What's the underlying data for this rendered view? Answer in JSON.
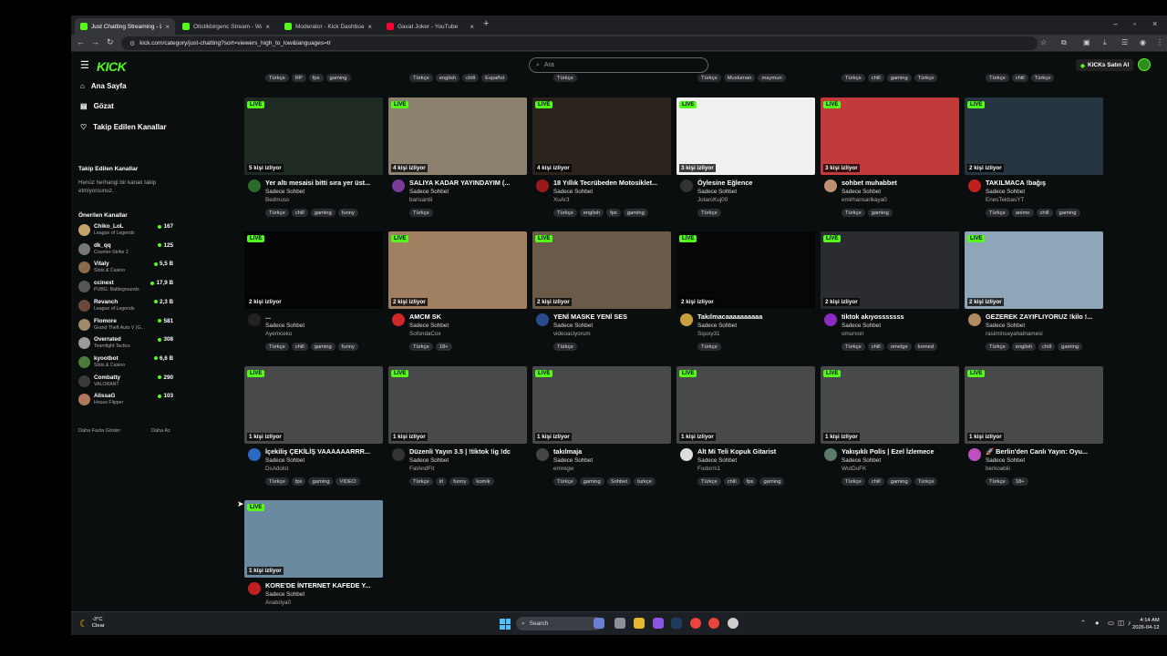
{
  "browser": {
    "tabs": [
      {
        "title": "Just Chatting Streaming - Live",
        "color": "#53fc18",
        "active": true
      },
      {
        "title": "Otistikbirgenc Stream - Watch",
        "color": "#53fc18",
        "active": false
      },
      {
        "title": "Moderator - Kick Dashboard",
        "color": "#53fc18",
        "active": false
      },
      {
        "title": "Gavat Joker - YouTube",
        "color": "#ff0033",
        "active": false
      }
    ],
    "new_tab": "+",
    "url": "kick.com/category/just-chatting?sort=viewers_high_to_low&languages=tr"
  },
  "header": {
    "logo": "KICK",
    "search_placeholder": "Ara",
    "kicks_button": "KICKs Satın Al"
  },
  "sidebar": {
    "nav": [
      {
        "label": "Ana Sayfa",
        "icon": "home-icon"
      },
      {
        "label": "Gözat",
        "icon": "browse-icon"
      },
      {
        "label": "Takip Edilen Kanallar",
        "icon": "heart-icon"
      }
    ],
    "followed_title": "Takip Edilen Kanallar",
    "followed_empty": "Henüz herhangi bir kanalı takip etmiyorsunuz.",
    "recommended_title": "Önerilen Kanallar",
    "channels": [
      {
        "name": "Chiko_LoL",
        "category": "League of Legends",
        "viewers": "167",
        "color": "#c4a36b"
      },
      {
        "name": "dk_qq",
        "category": "Counter-Strike 2",
        "viewers": "125",
        "color": "#777777"
      },
      {
        "name": "Vitaly",
        "category": "Slots & Casino",
        "viewers": "5,5 B",
        "color": "#8a6a4a"
      },
      {
        "name": "ccinext",
        "category": "PUBG: Battlegrounds",
        "viewers": "17,9 B",
        "color": "#555555"
      },
      {
        "name": "Revanch",
        "category": "League of Legends",
        "viewers": "2,3 B",
        "color": "#6b4a3a"
      },
      {
        "name": "Flomore",
        "category": "Grand Theft Auto V (G...",
        "viewers": "581",
        "color": "#a08a6a"
      },
      {
        "name": "Overrated",
        "category": "Teamfight Tactics",
        "viewers": "308",
        "color": "#9a9a9a"
      },
      {
        "name": "kyootbot",
        "category": "Slots & Casino",
        "viewers": "6,6 B",
        "color": "#4a7a3a"
      },
      {
        "name": "Combatty",
        "category": "VALORANT",
        "viewers": "290",
        "color": "#3a3a3a"
      },
      {
        "name": "AlissaG",
        "category": "House Flipper",
        "viewers": "103",
        "color": "#b07a5a"
      }
    ],
    "show_more": "Daha Fazla Göster",
    "show_less": "Daha Az"
  },
  "previous_row_tags": [
    [
      "Türkçe",
      "RP",
      "fps",
      "gaming"
    ],
    [
      "Türkçe",
      "english",
      "chill",
      "Español"
    ],
    [
      "Türkçe"
    ],
    [
      "Türkçe",
      "Musluman",
      "maymun"
    ],
    [
      "Türkçe",
      "chill",
      "gaming",
      "Türkçe"
    ],
    [
      "Türkçe",
      "chill",
      "Türkçe"
    ]
  ],
  "streams": [
    {
      "title": "Yer altı mesaisi bitti sıra yer üst...",
      "category": "Sadece Sohbet",
      "user": "Bedmuss",
      "viewers": "5 kişi izliyor",
      "tags": [
        "Türkçe",
        "chill",
        "gaming",
        "funny"
      ],
      "thumb_bg": "#1e2a22",
      "avatar": "#2a6a2a"
    },
    {
      "title": "SALIYA KADAR YAYINDAYIM (...",
      "category": "Sadece Sohbet",
      "user": "barisantii",
      "viewers": "4 kişi izliyor",
      "tags": [
        "Türkçe"
      ],
      "thumb_bg": "#8d8270",
      "avatar": "#7a3a9a"
    },
    {
      "title": "18 Yıllık Tecrübeden Motosiklet...",
      "category": "Sadece Sohbet",
      "user": "XuAr3",
      "viewers": "4 kişi izliyor",
      "tags": [
        "Türkçe",
        "english",
        "fps",
        "gaming"
      ],
      "thumb_bg": "#2a241c",
      "avatar": "#9a1a1a"
    },
    {
      "title": "Öylesine Eğlence",
      "category": "Sadece Sohbet",
      "user": "JotarcKuj00",
      "viewers": "3 kişi izliyor",
      "tags": [
        "Türkçe"
      ],
      "thumb_bg": "#f0f0f0",
      "avatar": "#333333"
    },
    {
      "title": "sohbet muhabbet",
      "category": "Sadece Sohbet",
      "user": "emirhansarikaya0",
      "viewers": "3 kişi izliyor",
      "tags": [
        "Türkçe",
        "gaming"
      ],
      "thumb_bg": "#c23a3a",
      "avatar": "#c09070"
    },
    {
      "title": "TAKILMACA !bağış",
      "category": "Sadece Sohbet",
      "user": "EnesTekbasYT",
      "viewers": "2 kişi izliyor",
      "tags": [
        "Türkçe",
        "anime",
        "chill",
        "gaming"
      ],
      "thumb_bg": "#263540",
      "avatar": "#c02020"
    },
    {
      "title": "...",
      "category": "Sadece Sohbet",
      "user": "Ayemceko",
      "viewers": "2 kişi izliyor",
      "tags": [
        "Türkçe",
        "chill",
        "gaming",
        "funny"
      ],
      "thumb_bg": "#050505",
      "avatar": "#222222"
    },
    {
      "title": "AMCM SK",
      "category": "Sadece Sohbet",
      "user": "SofondaCox",
      "viewers": "2 kişi izliyor",
      "tags": [
        "Türkçe",
        "18+"
      ],
      "thumb_bg": "#a08060",
      "avatar": "#d02828"
    },
    {
      "title": "YENİ MASKE YENİ SES",
      "category": "Sadece Sohbet",
      "user": "videoaciyorum",
      "viewers": "2 kişi izliyor",
      "tags": [
        "Türkçe"
      ],
      "thumb_bg": "#6a5a48",
      "avatar": "#2a4a8a"
    },
    {
      "title": "Takılmacaaaaaaaaaa",
      "category": "Sadece Sohbet",
      "user": "Squxy31",
      "viewers": "2 kişi izliyor",
      "tags": [
        "Türkçe"
      ],
      "thumb_bg": "#060606",
      "avatar": "#c8a040"
    },
    {
      "title": "tiktok akıyosssssss",
      "category": "Sadece Sohbet",
      "user": "omurvon",
      "viewers": "2 kişi izliyor",
      "tags": [
        "Türkçe",
        "chill",
        "omelge",
        "komed"
      ],
      "thumb_bg": "#2a2c30",
      "avatar": "#8a2ac0"
    },
    {
      "title": "GEZEREK ZAYIFLIYORUZ !kilo !...",
      "category": "Sadece Sohbet",
      "user": "rasiminseyahatnamesi",
      "viewers": "2 kişi izliyor",
      "tags": [
        "Türkçe",
        "english",
        "chill",
        "gaming"
      ],
      "thumb_bg": "#8fa6b8",
      "avatar": "#b08a60"
    },
    {
      "title": "İçekiliş ÇEKİLİŞ VAAAAAARRR...",
      "category": "Sadece Sohbet",
      "user": "DsAdolst",
      "viewers": "1 kişi izliyor",
      "tags": [
        "Türkçe",
        "fps",
        "gaming",
        "VIDEO"
      ],
      "thumb_bg": "#48494b",
      "avatar": "#2a6ac0"
    },
    {
      "title": "Düzenli Yayın 3.5 | !tiktok !ig !dc",
      "category": "Sadece Sohbet",
      "user": "FatAndFit",
      "viewers": "1 kişi izliyor",
      "tags": [
        "Türkçe",
        "irl",
        "funny",
        "komik"
      ],
      "thumb_bg": "#48494b",
      "avatar": "#333333"
    },
    {
      "title": "takılmaja",
      "category": "Sadece Sohbet",
      "user": "emregw",
      "viewers": "1 kişi izliyor",
      "tags": [
        "Türkçe",
        "gaming",
        "Sohbet",
        "turkçe"
      ],
      "thumb_bg": "#48494b",
      "avatar": "#444444"
    },
    {
      "title": "Alt Mi Teli Kopuk Gitarist",
      "category": "Sadece Sohbet",
      "user": "Fodorrs1",
      "viewers": "1 kişi izliyor",
      "tags": [
        "Türkçe",
        "chill",
        "fps",
        "gaming"
      ],
      "thumb_bg": "#48494b",
      "avatar": "#dddddd"
    },
    {
      "title": "Yakışıklı Polis | Ezel İzlemece",
      "category": "Sadece Sohbet",
      "user": "WutDuFK",
      "viewers": "1 kişi izliyor",
      "tags": [
        "Türkçe",
        "chill",
        "gaming",
        "Türkçe"
      ],
      "thumb_bg": "#48494b",
      "avatar": "#5a7a6a"
    },
    {
      "title": "🚀 Berlin'den Canlı Yayın: Oyu...",
      "category": "Sadece Sohbet",
      "user": "berkoabiii",
      "viewers": "1 kişi izliyor",
      "tags": [
        "Türkçe",
        "18+"
      ],
      "thumb_bg": "#48494b",
      "avatar": "#c050c0"
    },
    {
      "title": "KORE'DE İNTERNET KAFEDE Y...",
      "category": "Sadece Sohbet",
      "user": "Anatolya0",
      "viewers": "1 kişi izliyor",
      "tags": [],
      "thumb_bg": "#6b8aa0",
      "avatar": "#c02020"
    }
  ],
  "live_label": "LIVE",
  "taskbar": {
    "weather_temp": "-3°C",
    "weather_desc": "Clear",
    "search": "Search",
    "time": "4:14 AM",
    "date": "2026-04-12"
  }
}
